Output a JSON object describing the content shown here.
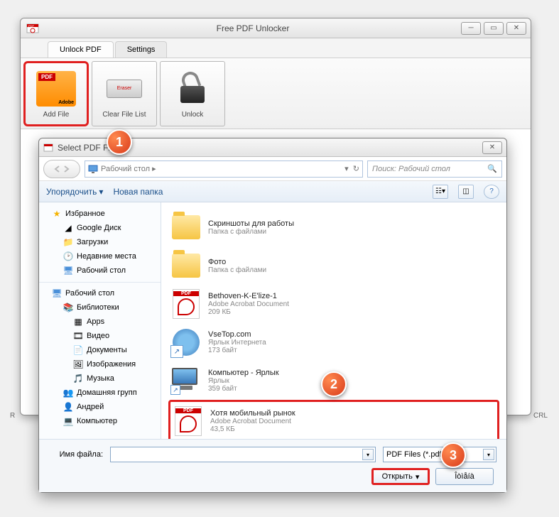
{
  "app": {
    "title": "Free PDF Unlocker",
    "tabs": {
      "unlock": "Unlock PDF",
      "settings": "Settings"
    },
    "ribbon": {
      "add_file": "Add File",
      "clear": "Clear File List",
      "unlock": "Unlock",
      "eraser_text": "Eraser"
    }
  },
  "dialog": {
    "title": "Select PDF File",
    "breadcrumb": "Рабочий стол  ▸",
    "search_placeholder": "Поиск: Рабочий стол",
    "toolbar": {
      "organize": "Упорядочить",
      "new_folder": "Новая папка"
    },
    "filename_label": "Имя файла:",
    "filter": "PDF Files (*.pdf)",
    "open": "Открыть",
    "cancel": "Îòìåíà"
  },
  "tree": {
    "favorites": "Избранное",
    "items1": [
      "Google Диск",
      "Загрузки",
      "Недавние места",
      "Рабочий стол"
    ],
    "desktop": "Рабочий стол",
    "libraries": "Библиотеки",
    "items2": [
      "Apps",
      "Видео",
      "Документы",
      "Изображения",
      "Музыка"
    ],
    "homegroup": "Домашняя групп",
    "user": "Андрей",
    "computer": "Компьютер"
  },
  "files": [
    {
      "name": "Скриншоты для работы",
      "meta1": "Папка с файлами",
      "meta2": "",
      "type": "folder"
    },
    {
      "name": "Фото",
      "meta1": "Папка с файлами",
      "meta2": "",
      "type": "folder"
    },
    {
      "name": "Bethoven-K-E'lize-1",
      "meta1": "Adobe Acrobat Document",
      "meta2": "209 КБ",
      "type": "pdf"
    },
    {
      "name": "VseTop.com",
      "meta1": "Ярлык Интернета",
      "meta2": "173 байт",
      "type": "url"
    },
    {
      "name": "Компьютер - Ярлык",
      "meta1": "Ярлык",
      "meta2": "359 байт",
      "type": "computer"
    },
    {
      "name": "Хотя мобильный рынок",
      "meta1": "Adobe Acrobat Document",
      "meta2": "43,5 КБ",
      "type": "pdf"
    }
  ],
  "callouts": {
    "c1": "1",
    "c2": "2",
    "c3": "3"
  },
  "bg": {
    "left": "R",
    "right": "CRL"
  }
}
